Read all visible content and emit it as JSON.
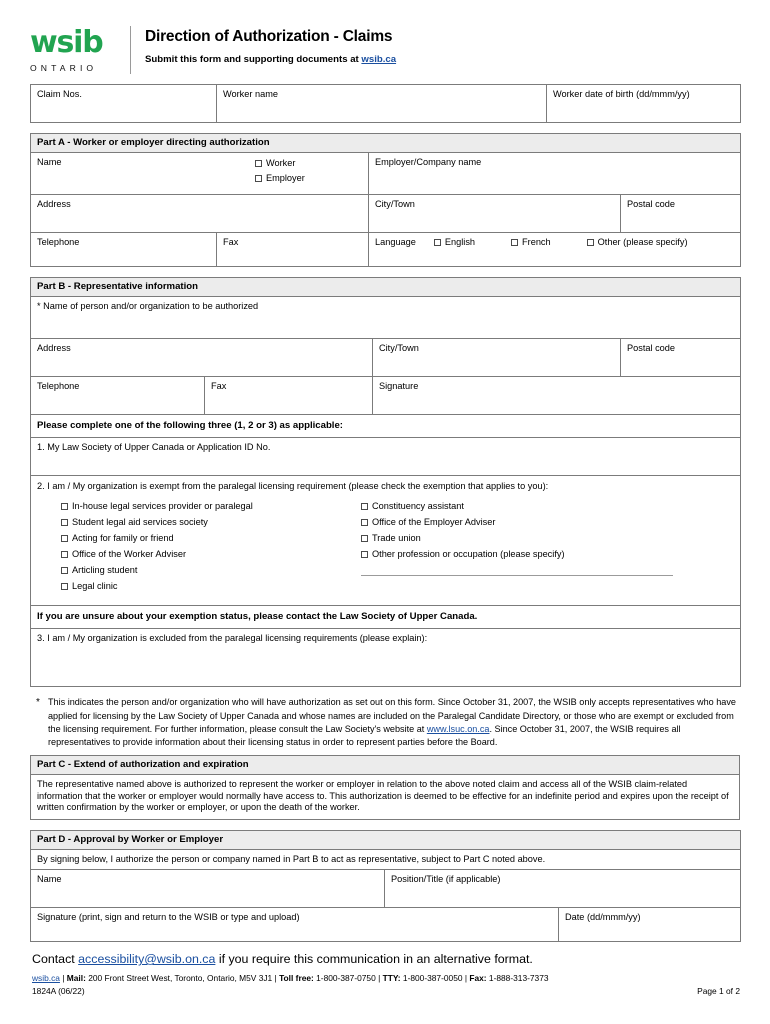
{
  "header": {
    "logo_word": "wsib",
    "logo_sub": "ONTARIO",
    "title": "Direction of Authorization - Claims",
    "subtitle_before": "Submit this form and supporting documents at ",
    "subtitle_link": "wsib.ca"
  },
  "claim_row": {
    "claim_nos": "Claim Nos.",
    "worker_name": "Worker name",
    "worker_dob": "Worker date of birth (dd/mmm/yy)"
  },
  "part_a": {
    "bar": "Part A - Worker or employer directing authorization",
    "name": "Name",
    "worker_cb": "Worker",
    "employer_cb": "Employer",
    "employer_company_name": "Employer/Company name",
    "address": "Address",
    "city_town": "City/Town",
    "postal_code": "Postal code",
    "telephone": "Telephone",
    "fax": "Fax",
    "language": "Language",
    "english_cb": "English",
    "french_cb": "French",
    "other_cb": "Other (please specify)"
  },
  "part_b": {
    "bar": "Part B - Representative information",
    "name_of_person": "* Name of person and/or organization to be authorized",
    "address": "Address",
    "city_town": "City/Town",
    "postal_code": "Postal code",
    "telephone": "Telephone",
    "fax": "Fax",
    "signature": "Signature",
    "complete_one_bar": "Please complete one of the following three (1, 2 or 3) as applicable:",
    "item1": "1. My Law Society of Upper Canada or Application ID No.",
    "item2": "2. I am / My organization is exempt from the paralegal licensing requirement (please check the exemption that applies to you):",
    "exempt_left": [
      "In-house legal services provider or paralegal",
      "Student legal aid services society",
      "Acting for family or friend",
      "Office of the Worker Adviser",
      "Articling student",
      "Legal clinic"
    ],
    "exempt_right": [
      "Constituency assistant",
      "Office of the Employer Adviser",
      "Trade union",
      "Other profession or occupation (please specify)"
    ],
    "unsure_bar": "If you are unsure about your exemption status, please contact the Law Society of Upper Canada.",
    "item3": "3. I am / My organization is excluded from the paralegal licensing requirements (please explain):"
  },
  "footnote": {
    "star": "*",
    "text_part1": "This indicates the person and/or organization who will have authorization as set out on this form. Since October 31, 2007, the WSIB only accepts representatives who have applied for licensing by the Law Society of Upper Canada and whose names are included on the Paralegal Candidate Directory, or those who are exempt or excluded from the licensing requirement. For further information, please consult the Law Society's website at ",
    "link": "www.lsuc.on.ca",
    "text_part2": ". Since October 31, 2007, the WSIB requires all representatives to provide information about their licensing status in order to represent parties before the Board."
  },
  "part_c": {
    "bar": "Part C - Extend of authorization and expiration",
    "body": "The representative named above is authorized to represent the worker or employer in relation to the above noted claim and access all of the WSIB claim-related information that the worker or employer would normally have access to. This authorization is deemed to be effective for an indefinite period and expires upon the receipt of written confirmation by the worker or employer, or upon the death of the worker."
  },
  "part_d": {
    "bar": "Part D - Approval by Worker or Employer",
    "statement": "By signing below, I authorize the person or company named in Part B to act as representative, subject to Part C noted above.",
    "name": "Name",
    "position_title": "Position/Title (if applicable)",
    "signature": "Signature (print, sign and return to the WSIB or type and upload)",
    "date": "Date (dd/mmm/yy)"
  },
  "footer": {
    "contact_before": "Contact ",
    "contact_email": "accessibility@wsib.on.ca",
    "contact_after": " if you require this communication in an alternative format.",
    "site_link": "wsib.ca",
    "mail_label": "Mail:",
    "mail_value": "200 Front Street West, Toronto, Ontario, M5V 3J1",
    "tollfree_label": "Toll free:",
    "tollfree_value": "1-800-387-0750",
    "tty_label": "TTY:",
    "tty_value": "1-800-387-0050",
    "fax_label": "Fax:",
    "fax_value": "1-888-313-7373",
    "form_code": "1824A (06/22)",
    "page_label": "Page 1 of 2"
  },
  "colors": {
    "brand_green": "#21a450",
    "link_blue": "#1a4fa0",
    "bar_grey": "#ececec",
    "border_grey": "#7b7b7b"
  }
}
